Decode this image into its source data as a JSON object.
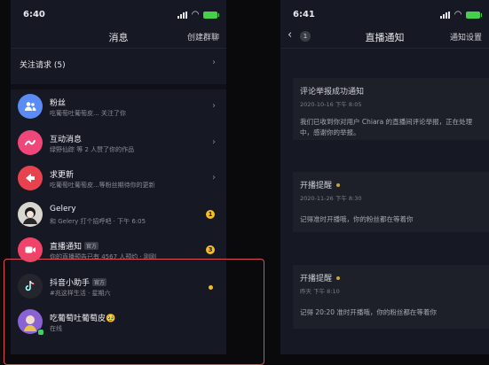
{
  "left": {
    "status": {
      "time": "6:40"
    },
    "title": "消息",
    "create_group": "创建群聊",
    "follow_requests": "关注请求 (5)",
    "messages": [
      {
        "name": "粉丝",
        "sub": "吃葡萄吐葡萄皮... 关注了你",
        "icon": "fans-icon",
        "color": "#5b8cf6"
      },
      {
        "name": "互动消息",
        "sub": "绿野仙踪 等 2 人赞了你的作品",
        "icon": "interact-icon",
        "color": "#f0477a"
      },
      {
        "name": "求更新",
        "sub": "吃葡萄吐葡萄皮...等粉丝期待你的更新",
        "icon": "update-icon",
        "color": "#e8424e"
      },
      {
        "name": "Gelery",
        "sub": "和 Gelery 打个招呼吧 · 下午 6:05",
        "badge": "1"
      },
      {
        "name": "直播通知",
        "tag": "官方",
        "sub": "你的直播预告已有 4567 人预约 · 刚刚",
        "icon": "live-icon",
        "color": "#f0436a",
        "badge": "3"
      },
      {
        "name": "抖音小助手",
        "tag": "官方",
        "sub": "#兆这样生活 · 星期六",
        "icon": "tiktok-icon",
        "color": "#24252d"
      },
      {
        "name": "吃葡萄吐葡萄皮🥹",
        "sub": "在线",
        "color": "#8a62d4"
      }
    ]
  },
  "right": {
    "status": {
      "time": "6:41"
    },
    "back_count": "1",
    "title": "直播通知",
    "settings": "通知设置",
    "cards": [
      {
        "title": "评论举报成功通知",
        "date": "2020-10-16 下午 8:05",
        "body": "我们已收到你对用户 Chiara 的直播间评论举报，正在处理中，感谢你的举报。"
      },
      {
        "title": "开播提醒",
        "date": "2020-11-26 下午 8:30",
        "body": "记得准时开播哦，你的粉丝都在等着你"
      },
      {
        "title": "开播提醒",
        "date": "昨天 下午 8:10",
        "body": "记得 20:20 准时开播哦，你的粉丝都在等着你"
      }
    ]
  }
}
